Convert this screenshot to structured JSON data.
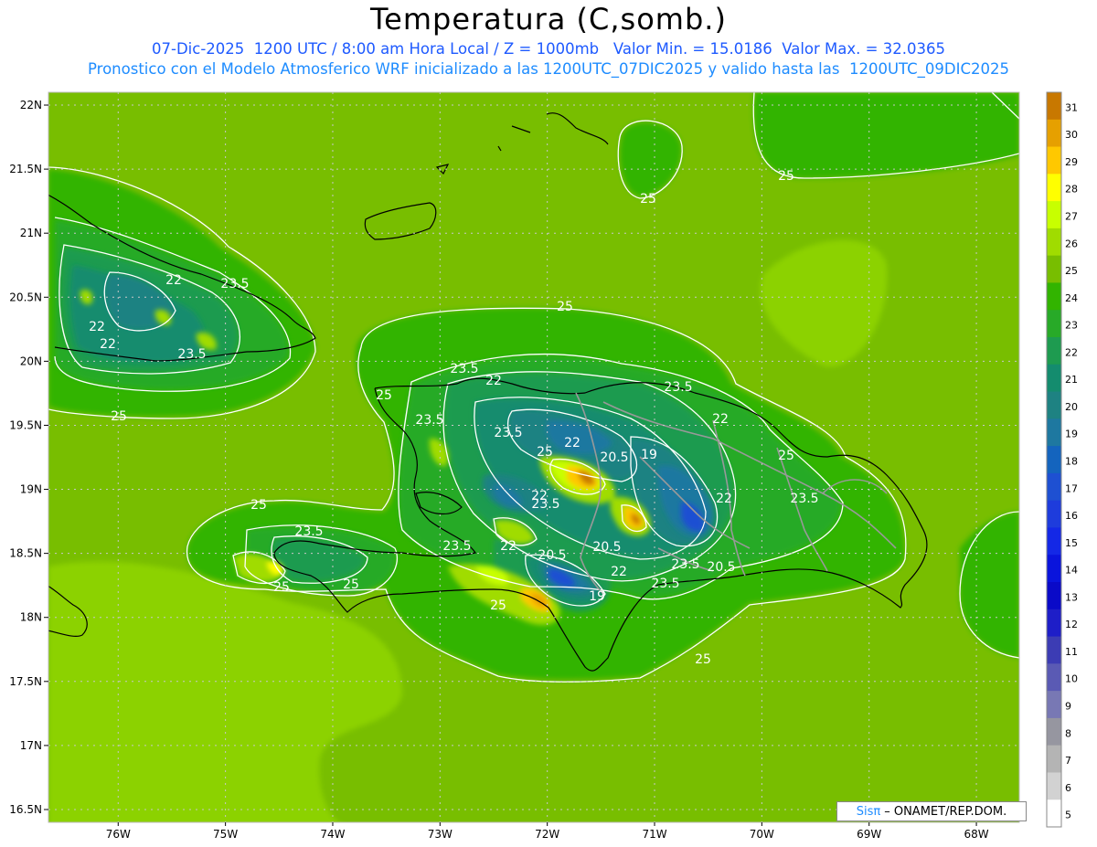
{
  "header": {
    "title": "Temperatura (C,somb.)",
    "line1": "07-Dic-2025  1200 UTC / 8:00 am Hora Local / Z = 1000mb   Valor Min. = 15.0186  Valor Max. = 32.0365",
    "line2": "Pronostico con el Modelo Atmosferico WRF inicializado a las 1200UTC_07DIC2025 y valido hasta las  1200UTC_09DIC2025"
  },
  "axes": {
    "lat_labels": [
      "22N",
      "21.5N",
      "21N",
      "20.5N",
      "20N",
      "19.5N",
      "19N",
      "18.5N",
      "18N",
      "17.5N",
      "17N",
      "16.5N"
    ],
    "lat_values": [
      22,
      21.5,
      21,
      20.5,
      20,
      19.5,
      19,
      18.5,
      18,
      17.5,
      17,
      16.5
    ],
    "lon_labels": [
      "76W",
      "75W",
      "74W",
      "73W",
      "72W",
      "71W",
      "70W",
      "69W",
      "68W"
    ],
    "lon_values": [
      -76,
      -75,
      -74,
      -73,
      -72,
      -71,
      -70,
      -69,
      -68
    ]
  },
  "colorbar": {
    "labels": [
      "31",
      "30",
      "29",
      "28",
      "27",
      "26",
      "25",
      "24",
      "23",
      "22",
      "21",
      "20",
      "19",
      "18",
      "17",
      "16",
      "15",
      "14",
      "13",
      "12",
      "11",
      "10",
      "9",
      "8",
      "7",
      "6",
      "5"
    ],
    "colors": [
      "#c87800",
      "#e6a000",
      "#ffc800",
      "#ffff00",
      "#c8ff00",
      "#a0dc00",
      "#78be00",
      "#32b400",
      "#28aa28",
      "#1e9b50",
      "#148c6e",
      "#1e8282",
      "#1e78a0",
      "#1464be",
      "#1e50d2",
      "#1e3cdc",
      "#1428e6",
      "#0a14dc",
      "#0a0ac8",
      "#1e1ec8",
      "#3c3cb4",
      "#5a5ab4",
      "#7878b4",
      "#9696a0",
      "#b4b4b4",
      "#d2d2d2",
      "#ffffff"
    ]
  },
  "contour_labels": [
    "25",
    "25",
    "25",
    "25",
    "25",
    "25",
    "25",
    "25",
    "25",
    "25",
    "25",
    "25",
    "23.5",
    "23.5",
    "23.5",
    "23.5",
    "23.5",
    "23.5",
    "23.5",
    "23.5",
    "23.5",
    "23.5",
    "23.5",
    "23.5",
    "22",
    "22",
    "22",
    "22",
    "22",
    "22",
    "22",
    "22",
    "22",
    "22",
    "20.5",
    "20.5",
    "20.5",
    "20.5",
    "19",
    "19"
  ],
  "credit": {
    "sis": "Sisπ",
    "org": "– ONAMET/REP.DOM."
  }
}
